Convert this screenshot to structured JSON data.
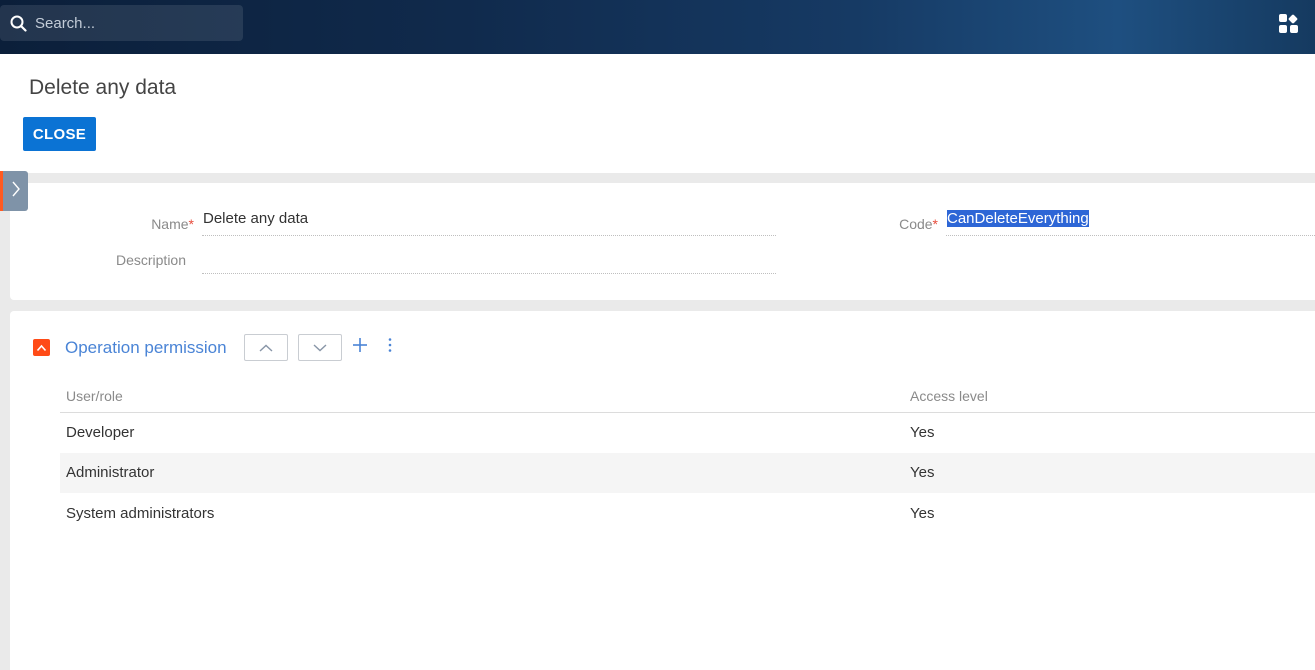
{
  "search": {
    "placeholder": "Search..."
  },
  "page": {
    "title": "Delete any data",
    "close_label": "CLOSE"
  },
  "fields": {
    "name_label": "Name",
    "name_value": "Delete any data",
    "description_label": "Description",
    "description_value": "",
    "code_label": "Code",
    "code_value": "CanDeleteEverything",
    "required_mark": "*"
  },
  "detail": {
    "title": "Operation permission",
    "columns": [
      "User/role",
      "Access level"
    ],
    "rows": [
      {
        "user": "Developer",
        "access": "Yes"
      },
      {
        "user": "Administrator",
        "access": "Yes"
      },
      {
        "user": "System administrators",
        "access": "Yes"
      }
    ]
  },
  "colors": {
    "accent": "#0b73d4",
    "brand_orange": "#ff4b17",
    "link_blue": "#4a84d6",
    "highlight": "#2d66d6"
  },
  "icons": [
    "search-icon",
    "apps-icon",
    "chevron-right-icon",
    "chevron-up-icon",
    "chevron-down-icon",
    "plus-icon",
    "more-vertical-icon"
  ]
}
